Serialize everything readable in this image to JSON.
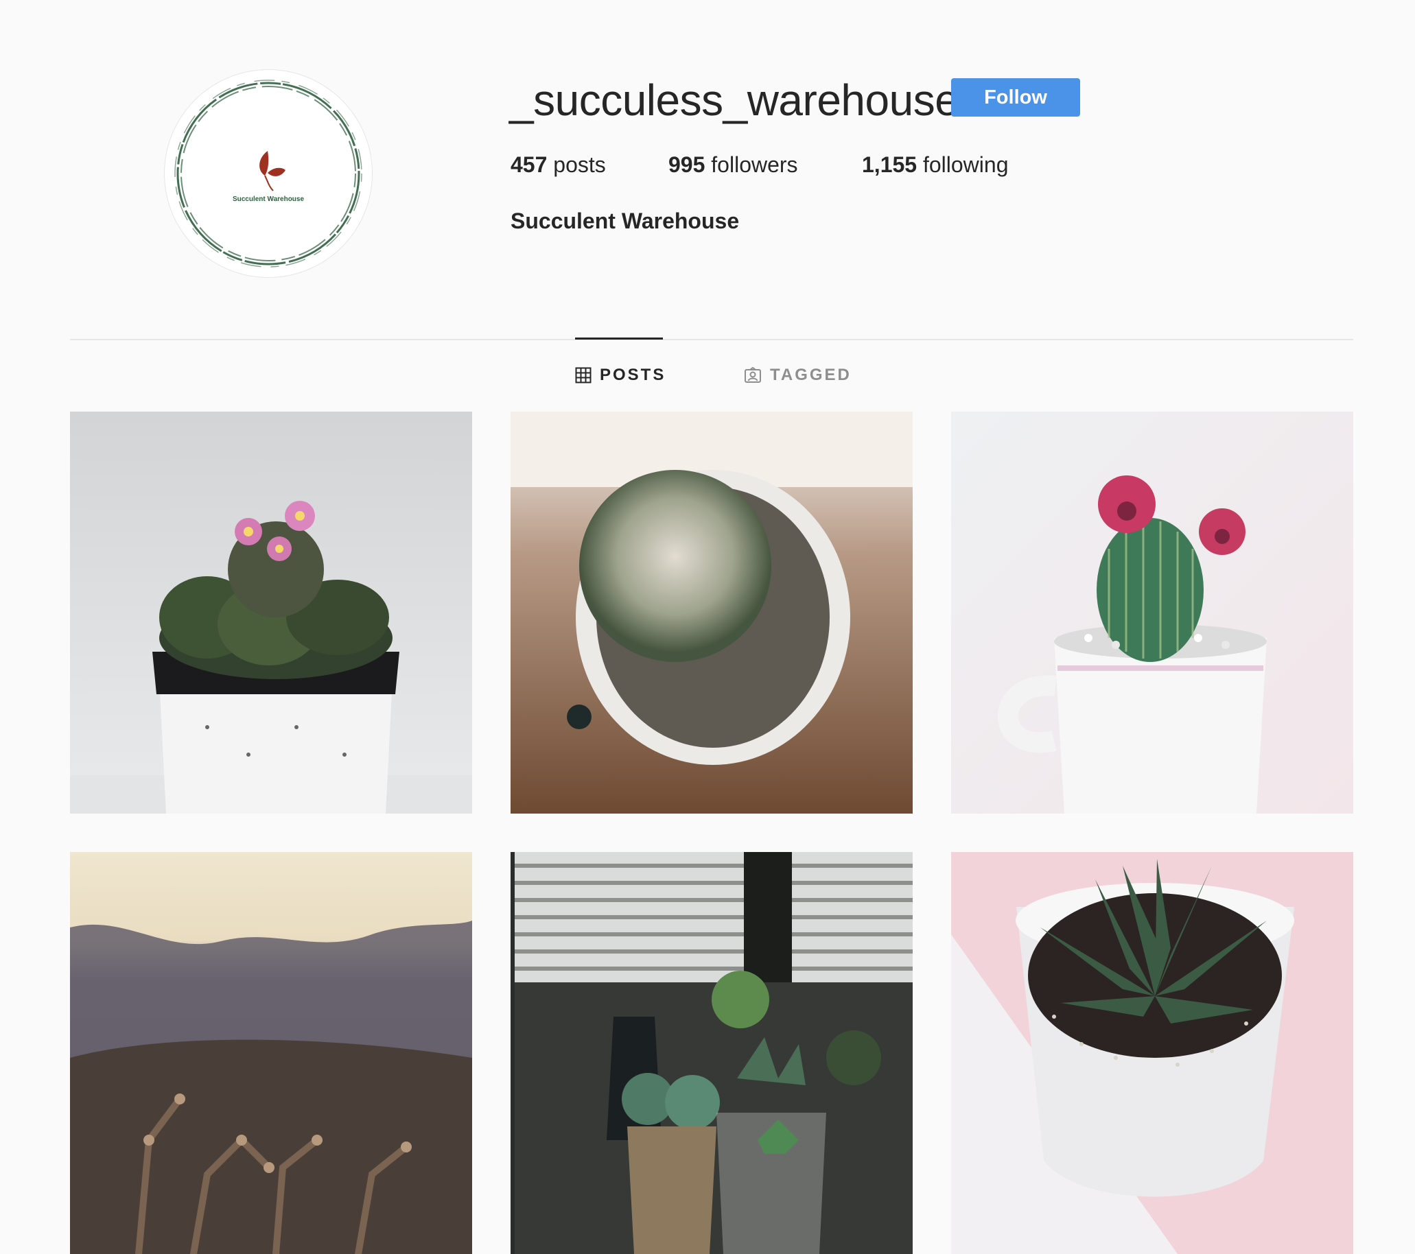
{
  "profile": {
    "username": "_succuless_warehouse",
    "follow_label": "Follow",
    "full_name": "Succulent Warehouse",
    "avatar_logo_text": "Succulent Warehouse"
  },
  "stats": {
    "posts_count": "457",
    "posts_label": "posts",
    "followers_count": "995",
    "followers_label": "followers",
    "following_count": "1,155",
    "following_label": "following"
  },
  "tabs": [
    {
      "label": "POSTS",
      "icon": "grid-icon",
      "active": true
    },
    {
      "label": "TAGGED",
      "icon": "tagged-icon",
      "active": false
    }
  ],
  "posts": [
    {
      "subject": "flowering mammillaria cactus in white pot",
      "icon": "post-photo"
    },
    {
      "subject": "round cactus from above in white pot",
      "icon": "post-photo"
    },
    {
      "subject": "cactus with pink flowers in white mug",
      "icon": "post-photo"
    },
    {
      "subject": "desert cholla cactus at dusk",
      "icon": "post-photo"
    },
    {
      "subject": "potted succulents by window blinds",
      "icon": "post-photo"
    },
    {
      "subject": "haworthia succulent in white pot on pink",
      "icon": "post-photo"
    }
  ],
  "colors": {
    "accent": "#4a93e9",
    "background": "#fafafa",
    "text": "#262626",
    "muted": "#8e8e8e",
    "logo_leaf": "#a0301f",
    "logo_ring": "#2d5e3e"
  }
}
